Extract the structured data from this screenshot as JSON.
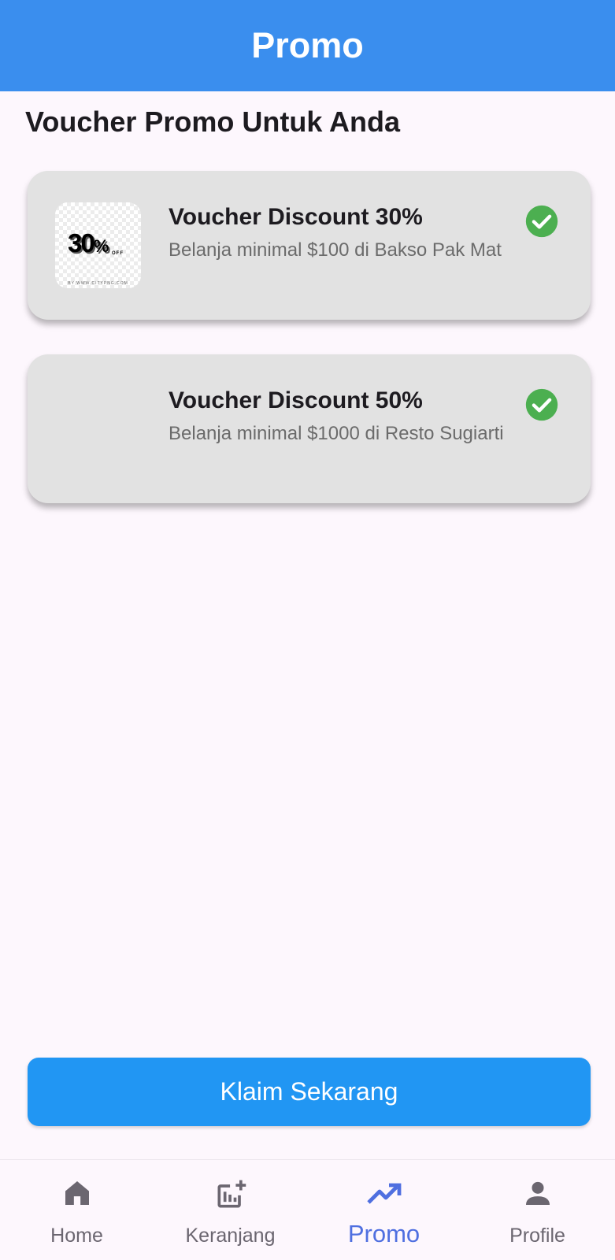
{
  "appbar": {
    "title": "Promo",
    "color": "#3a8eee"
  },
  "section": {
    "title": "Voucher Promo Untuk Anda"
  },
  "vouchers": [
    {
      "title": "Voucher Discount 30%",
      "description": "Belanja minimal $100 di Bakso Pak Mat",
      "thumbnail": {
        "big": "30",
        "pct": "%",
        "off": "OFF",
        "caption": "BY WWW.CITYPNG.COM"
      },
      "selected": true
    },
    {
      "title": "Voucher Discount 50%",
      "description": "Belanja minimal $1000 di Resto Sugiarti",
      "selected": true
    }
  ],
  "claim_button": {
    "label": "Klaim Sekarang",
    "color": "#2196f3"
  },
  "bottom_nav": {
    "items": [
      {
        "label": "Home",
        "icon": "home-icon"
      },
      {
        "label": "Keranjang",
        "icon": "chart-add-icon"
      },
      {
        "label": "Promo",
        "icon": "trending-up-icon",
        "active": true
      },
      {
        "label": "Profile",
        "icon": "person-icon"
      }
    ],
    "active_color": "#4f6fe0"
  },
  "colors": {
    "check": "#4caf50",
    "card": "#e2e2e2",
    "background": "#fdf7fd"
  }
}
